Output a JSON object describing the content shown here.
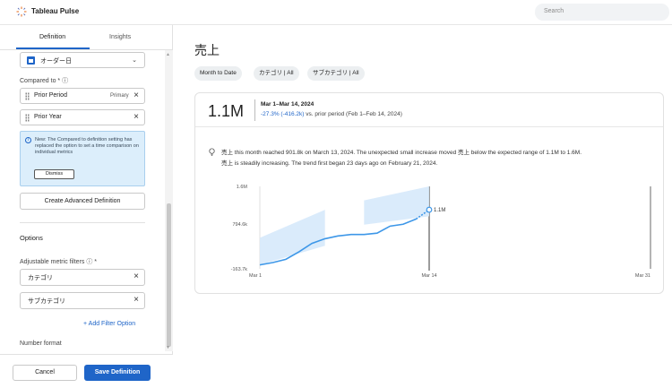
{
  "app": {
    "title": "Tableau Pulse",
    "search_placeholder": "Search"
  },
  "sidebar": {
    "tabs": [
      "Definition",
      "Insights"
    ],
    "active_tab": "Definition",
    "date_field": "オーダー日",
    "compared_label": "Compared to *",
    "comparisons": [
      {
        "label": "Prior Period",
        "tag": "Primary"
      },
      {
        "label": "Prior Year",
        "tag": ""
      }
    ],
    "info_message": "New: The Compared to definition setting has replaced the option to set a time comparison on individual metrics",
    "dismiss_label": "Dismiss",
    "advanced_label": "Create Advanced Definition",
    "options_title": "Options",
    "filters_label": "Adjustable metric filters",
    "filters": [
      "カテゴリ",
      "サブカテゴリ"
    ],
    "add_filter_label": "+ Add Filter Option",
    "number_format_label": "Number format",
    "cancel_label": "Cancel",
    "save_label": "Save Definition"
  },
  "main": {
    "metric_title": "売上",
    "chips": [
      "Month to Date",
      "カテゴリ | All",
      "サブカテゴリ | All"
    ],
    "value": "1.1M",
    "period": "Mar 1–Mar 14, 2024",
    "delta_change": "-27.3% (-416.2k)",
    "delta_rest": " vs. prior period (Feb 1–Feb 14, 2024)",
    "insight_line1": "売上 this month reached 901.8k on March 13, 2024. The unexpected small increase moved 売上 below the expected range of 1.1M to 1.6M.",
    "insight_line2": "売上 is steadily increasing. The trend first began 23 days ago on February 21, 2024."
  },
  "colors": {
    "accent": "#1f65c8",
    "line": "#3d97e8",
    "band": "#d6e9fb"
  },
  "chart_data": {
    "type": "line",
    "x_ticks": [
      "Mar 1",
      "Mar 14",
      "Mar 31"
    ],
    "y_ticks": [
      "1.6M",
      "794.6k",
      "-163.7k"
    ],
    "ylim": [
      -163700,
      1600000
    ],
    "end_label": "1.1M",
    "series": [
      {
        "name": "",
        "x": [
          1,
          2,
          3,
          4,
          5,
          6,
          7,
          8,
          9,
          10,
          11,
          12,
          13,
          14
        ],
        "values": [
          -80000,
          -30000,
          40000,
          200000,
          380000,
          480000,
          540000,
          570000,
          570000,
          600000,
          750000,
          790000,
          901800,
          1100000
        ]
      }
    ],
    "expected_range": [
      {
        "x": [
          1,
          6
        ],
        "low": [
          -80000,
          330000
        ],
        "high": [
          500000,
          1100000
        ]
      },
      {
        "x": [
          9,
          14
        ],
        "low": [
          780000,
          960000
        ],
        "high": [
          1300000,
          1600000
        ]
      }
    ]
  }
}
